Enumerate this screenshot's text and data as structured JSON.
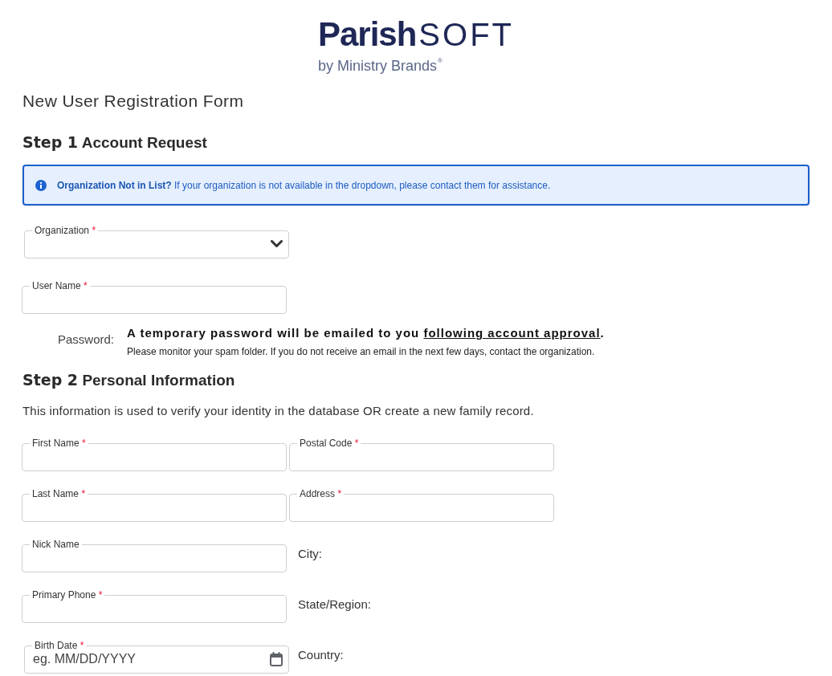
{
  "logo": {
    "wordmark_bold": "Parish",
    "wordmark_light": "SOFT",
    "tagline": "by Ministry Brands",
    "trademark": "®"
  },
  "title": "New User Registration Form",
  "step1": {
    "step": "Step 1",
    "title": "Account Request",
    "alert": {
      "message": "**Organization Not in List?** If your organization is not available in the dropdown, please contact them for assistance."
    },
    "fields": [
      {
        "kind": "select",
        "label": "Organization",
        "required_mark": "*"
      },
      {
        "kind": "text",
        "label": "User Name",
        "required_mark": "*"
      }
    ],
    "password": {
      "label": "Password:",
      "notice": "A temporary password will be emailed to you ",
      "link": "following account approval",
      "notice_end": ".",
      "note": "Please monitor your spam folder. If you do not receive an email in the next few days, contact the organization."
    }
  },
  "step2": {
    "step": "Step 2",
    "title": "Personal Information",
    "description": "This information is used to verify your identity in the database OR create a new family record.",
    "fields": [
      {
        "kind": "text",
        "label": "First Name",
        "required_mark": "*"
      },
      {
        "kind": "text",
        "label": "Postal Code",
        "required_mark": "*"
      },
      {
        "kind": "text",
        "label": "Last Name",
        "required_mark": "*"
      },
      {
        "kind": "text",
        "label": "Address",
        "required_mark": "*"
      },
      {
        "kind": "text",
        "label": "Nick Name"
      },
      {
        "kind": "static",
        "label": "City:"
      },
      {
        "kind": "text",
        "label": "Primary Phone",
        "required_mark": "*"
      },
      {
        "kind": "static",
        "label": "State/Region:"
      },
      {
        "kind": "date",
        "label": "Birth Date",
        "required_mark": "*",
        "placeholder": "eg. MM/DD/YYYY"
      },
      {
        "kind": "static",
        "label": "Country:"
      }
    ]
  }
}
